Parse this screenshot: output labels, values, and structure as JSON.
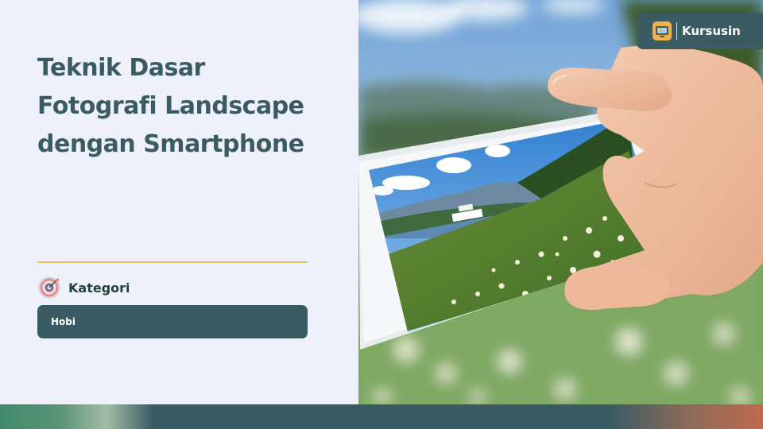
{
  "page": {
    "title_lines": [
      "Teknik Dasar",
      "Fotografi Landscape",
      "dengan Smartphone"
    ]
  },
  "category": {
    "heading": "Kategori",
    "icon": "target-icon",
    "value": "Hobi"
  },
  "brand": {
    "name": "Kursusin",
    "icon": "kursusin-logo"
  },
  "photo": {
    "subject": "hand holding smartphone photographing landscape"
  },
  "colors": {
    "primary": "#3b5b63",
    "accent": "#e3c072",
    "background": "#eff1fa",
    "heading": "#234237"
  }
}
